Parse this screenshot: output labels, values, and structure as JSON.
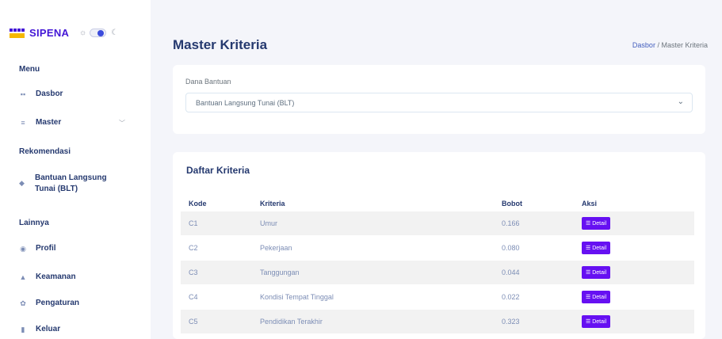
{
  "brand": {
    "name": "SIPENA"
  },
  "sidebar": {
    "menu_title": "Menu",
    "dasbor": "Dasbor",
    "master": "Master",
    "rekomendasi_title": "Rekomendasi",
    "blt_line1": "Bantuan Langsung",
    "blt_line2": "Tunai (BLT)",
    "lainnya_title": "Lainnya",
    "profil": "Profil",
    "keamanan": "Keamanan",
    "pengaturan": "Pengaturan",
    "keluar": "Keluar"
  },
  "header": {
    "title": "Master Kriteria",
    "breadcrumb_home": "Dasbor",
    "breadcrumb_sep": "/",
    "breadcrumb_current": "Master Kriteria"
  },
  "filter": {
    "label": "Dana Bantuan",
    "selected": "Bantuan Langsung Tunai (BLT)"
  },
  "table": {
    "title": "Daftar Kriteria",
    "headers": {
      "kode": "Kode",
      "kriteria": "Kriteria",
      "bobot": "Bobot",
      "aksi": "Aksi"
    },
    "rows": [
      {
        "kode": "C1",
        "kriteria": "Umur",
        "bobot": "0.166",
        "aksi": "Detail"
      },
      {
        "kode": "C2",
        "kriteria": "Pekerjaan",
        "bobot": "0.080",
        "aksi": "Detail"
      },
      {
        "kode": "C3",
        "kriteria": "Tanggungan",
        "bobot": "0.044",
        "aksi": "Detail"
      },
      {
        "kode": "C4",
        "kriteria": "Kondisi Tempat Tinggal",
        "bobot": "0.022",
        "aksi": "Detail"
      },
      {
        "kode": "C5",
        "kriteria": "Pendidikan Terakhir",
        "bobot": "0.323",
        "aksi": "Detail"
      }
    ]
  },
  "colors": {
    "brand": "#4316d6",
    "accent": "#6610f2",
    "link": "#435ebe"
  },
  "icons": [
    "grid-icon",
    "database-icon",
    "diamond-icon",
    "user-icon",
    "lock-icon",
    "gear-icon",
    "logout-icon",
    "chevron-down-icon",
    "list-icon",
    "sun-icon",
    "moon-icon"
  ]
}
